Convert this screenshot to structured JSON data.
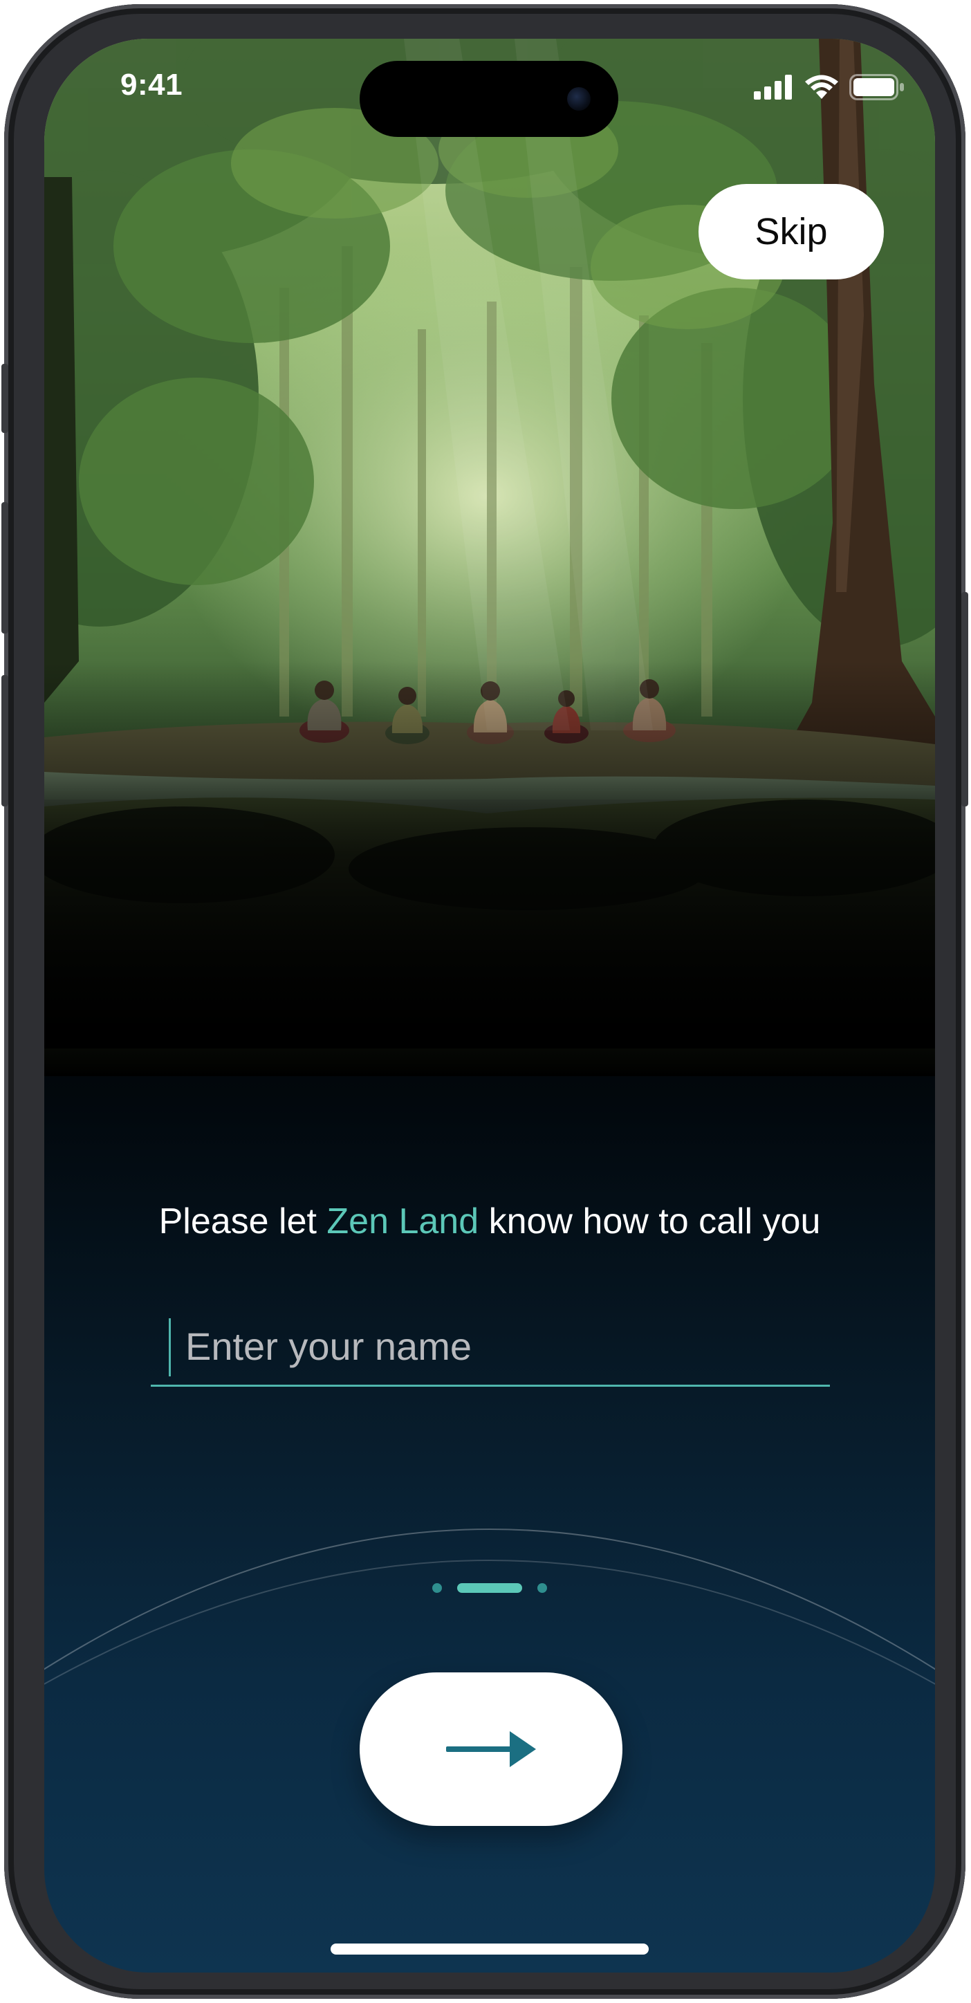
{
  "status_bar": {
    "time": "9:41",
    "icons": [
      "cellular-signal-icon",
      "wifi-icon",
      "battery-icon"
    ]
  },
  "header": {
    "skip_label": "Skip"
  },
  "hero": {
    "image": "forest-meditation-illustration",
    "people_count": 5
  },
  "onboarding": {
    "prompt_before": "Please let ",
    "prompt_brand": "Zen Land",
    "prompt_after": " know how to call you",
    "name_input": {
      "value": "",
      "placeholder": "Enter your name"
    },
    "pager": {
      "count": 3,
      "active_index": 1
    },
    "next_icon": "arrow-right-icon"
  },
  "colors": {
    "accent": "#5cc8b8",
    "underline": "#4fb6ad",
    "arrow": "#1b6f82",
    "bg_bottom": "#0e3450"
  }
}
